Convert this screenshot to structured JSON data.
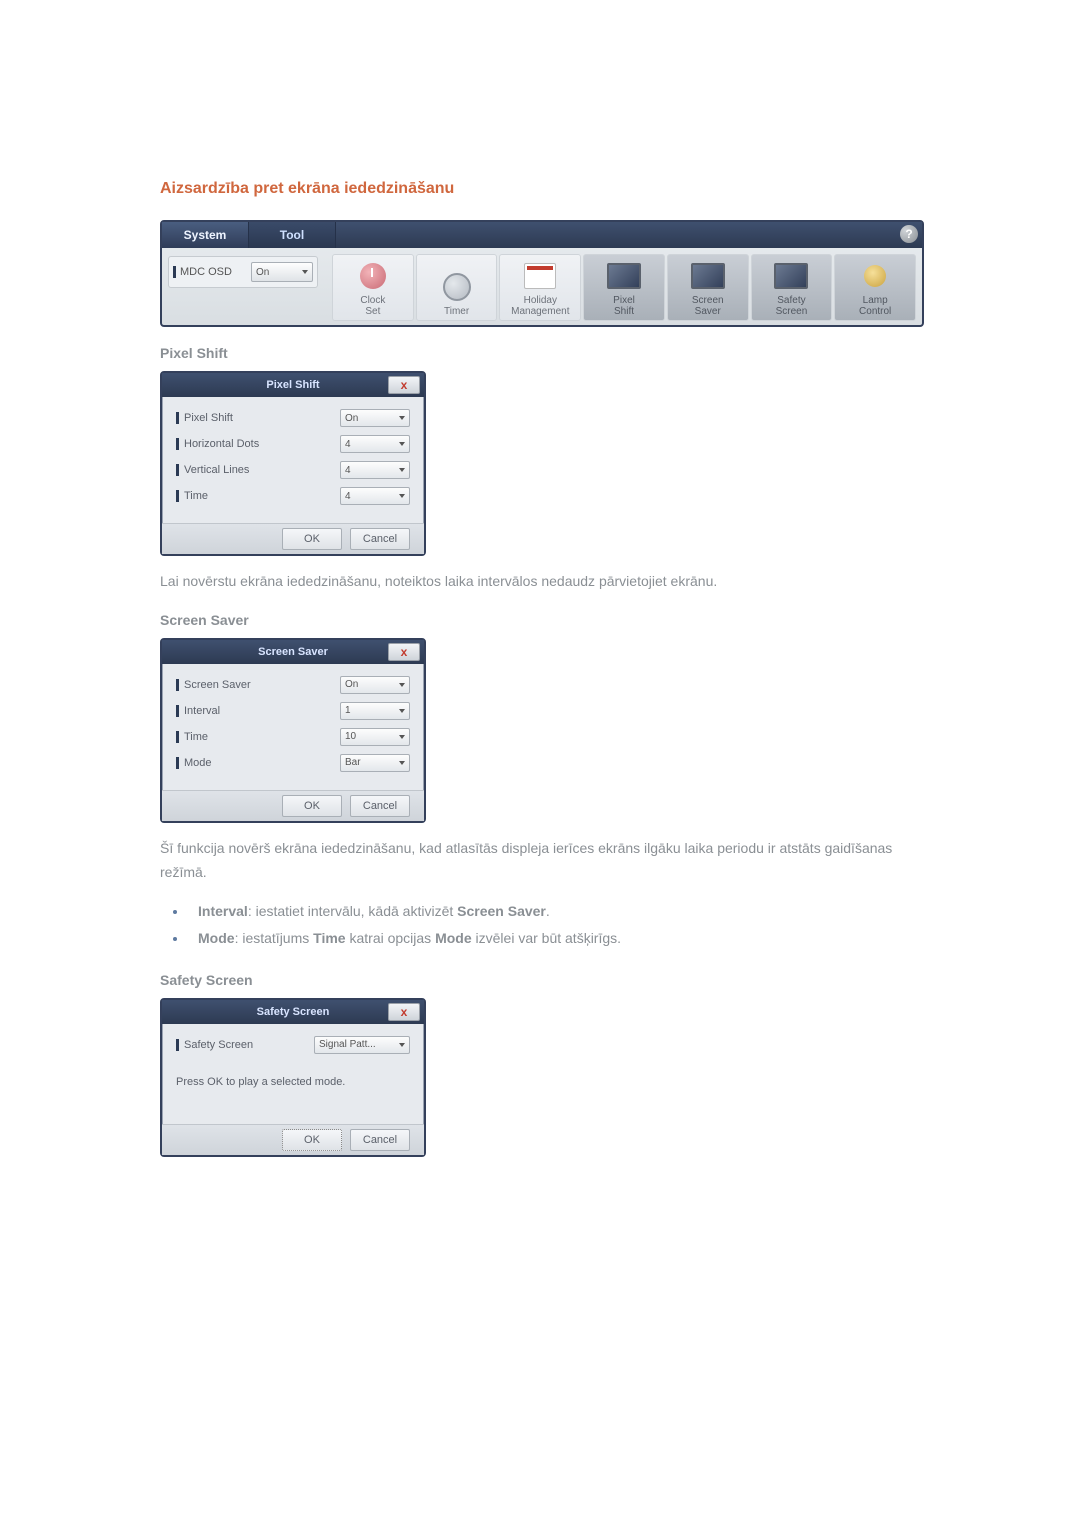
{
  "heading": "Aizsardzība pret ekrāna iededzināšanu",
  "toolbar": {
    "tabs": {
      "system": "System",
      "tool": "Tool"
    },
    "help": "?",
    "mdc": {
      "label": "MDC OSD",
      "value": "On"
    },
    "items": {
      "clock": "Clock\nSet",
      "timer": "Timer",
      "holiday": "Holiday\nManagement",
      "pixel": "Pixel\nShift",
      "saver": "Screen\nSaver",
      "safety": "Safety\nScreen",
      "lamp": "Lamp\nControl"
    }
  },
  "pixelShift": {
    "heading": "Pixel Shift",
    "title": "Pixel Shift",
    "rows": {
      "pixel": {
        "label": "Pixel Shift",
        "value": "On"
      },
      "hdots": {
        "label": "Horizontal Dots",
        "value": "4"
      },
      "vlines": {
        "label": "Vertical Lines",
        "value": "4"
      },
      "time": {
        "label": "Time",
        "value": "4"
      }
    },
    "ok": "OK",
    "cancel": "Cancel",
    "desc": "Lai novērstu ekrāna iededzināšanu, noteiktos laika intervālos nedaudz pārvietojiet ekrānu."
  },
  "screenSaver": {
    "heading": "Screen Saver",
    "title": "Screen Saver",
    "rows": {
      "saver": {
        "label": "Screen Saver",
        "value": "On"
      },
      "interval": {
        "label": "Interval",
        "value": "1"
      },
      "time": {
        "label": "Time",
        "value": "10"
      },
      "mode": {
        "label": "Mode",
        "value": "Bar"
      }
    },
    "ok": "OK",
    "cancel": "Cancel",
    "desc": "Šī funkcija novērš ekrāna iededzināšanu, kad atlasītās displeja ierīces ekrāns ilgāku laika periodu ir atstāts gaidīšanas režīmā.",
    "bullets": {
      "interval": {
        "strong1": "Interval",
        "text1": ": iestatiet intervālu, kādā aktivizēt ",
        "strong2": "Screen Saver",
        "text2": "."
      },
      "mode": {
        "strong1": "Mode",
        "text1": ": iestatījums ",
        "strong2": "Time",
        "text2": " katrai opcijas ",
        "strong3": "Mode",
        "text3": " izvēlei var būt atšķirīgs."
      }
    }
  },
  "safetyScreen": {
    "heading": "Safety Screen",
    "title": "Safety Screen",
    "row": {
      "label": "Safety Screen",
      "value": "Signal Patt..."
    },
    "instruction": "Press OK to play a selected mode.",
    "ok": "OK",
    "cancel": "Cancel"
  }
}
